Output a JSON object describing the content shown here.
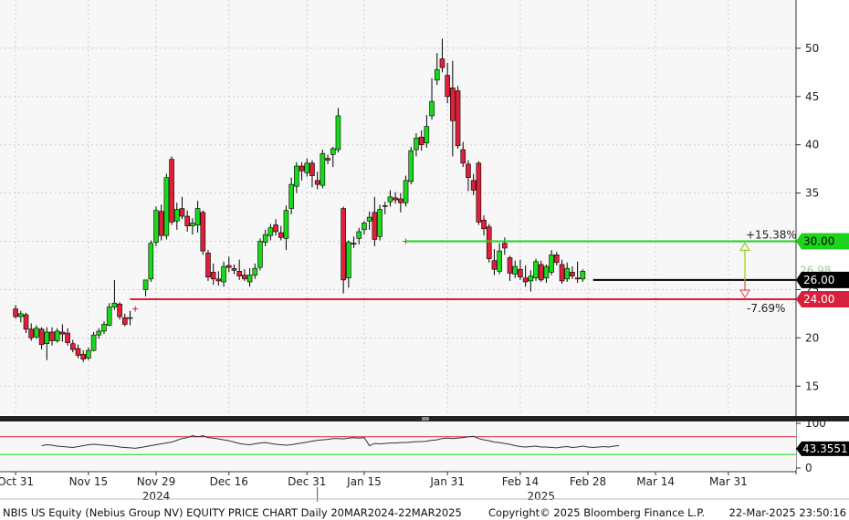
{
  "chart_data": {
    "type": "candlestick",
    "ylim": [
      12,
      55
    ],
    "yticks": [
      15,
      20,
      25,
      30,
      35,
      40,
      45,
      50
    ],
    "x_range": [
      -3,
      150
    ],
    "x_ticks": [
      {
        "i": 0,
        "label": "Oct 31"
      },
      {
        "i": 14,
        "label": "Nov 15"
      },
      {
        "i": 27,
        "label": "Nov 29"
      },
      {
        "i": 41,
        "label": "Dec 16"
      },
      {
        "i": 56,
        "label": "Dec 31"
      },
      {
        "i": 67,
        "label": "Jan 15"
      },
      {
        "i": 83,
        "label": "Jan 31"
      },
      {
        "i": 97,
        "label": "Feb 14"
      },
      {
        "i": 110,
        "label": "Feb 28"
      },
      {
        "i": 123,
        "label": "Mar 14"
      },
      {
        "i": 137,
        "label": "Mar 31"
      }
    ],
    "year_labels": [
      {
        "i": 27,
        "label": "2024"
      },
      {
        "i": 101,
        "label": "2025"
      }
    ],
    "candles": [
      [
        23.0,
        23.4,
        22.0,
        22.2
      ],
      [
        22.2,
        22.8,
        21.6,
        22.5
      ],
      [
        22.4,
        22.6,
        20.5,
        20.9
      ],
      [
        20.9,
        21.5,
        19.7,
        20.0
      ],
      [
        20.1,
        21.3,
        19.9,
        21.0
      ],
      [
        20.9,
        21.1,
        18.8,
        19.3
      ],
      [
        19.4,
        21.1,
        17.7,
        20.6
      ],
      [
        20.6,
        21.1,
        19.2,
        19.7
      ],
      [
        19.7,
        21.0,
        19.5,
        20.7
      ],
      [
        20.6,
        21.4,
        19.6,
        20.4
      ],
      [
        20.5,
        21.0,
        19.2,
        19.5
      ],
      [
        19.4,
        19.8,
        18.5,
        18.8
      ],
      [
        18.9,
        19.3,
        17.9,
        18.2
      ],
      [
        18.3,
        18.7,
        17.5,
        17.8
      ],
      [
        17.9,
        19.0,
        17.7,
        18.7
      ],
      [
        18.7,
        20.6,
        18.6,
        20.3
      ],
      [
        20.3,
        21.0,
        19.9,
        20.7
      ],
      [
        20.7,
        21.7,
        20.4,
        21.4
      ],
      [
        21.3,
        23.6,
        21.2,
        23.2
      ],
      [
        23.2,
        26.0,
        22.9,
        23.6
      ],
      [
        23.5,
        23.7,
        21.9,
        22.2
      ],
      [
        22.1,
        22.5,
        21.2,
        21.4
      ],
      [
        22.0,
        22.8,
        21.3,
        22.1
      ],
      [
        0,
        0,
        0,
        0
      ],
      [
        0,
        0,
        0,
        0
      ],
      [
        25.0,
        25.5,
        24.3,
        26.0
      ],
      [
        26.1,
        30.1,
        25.8,
        29.8
      ],
      [
        29.9,
        33.6,
        29.5,
        33.2
      ],
      [
        33.1,
        33.8,
        30.1,
        30.6
      ],
      [
        30.6,
        37.0,
        30.2,
        36.6
      ],
      [
        38.5,
        38.8,
        31.7,
        32.0
      ],
      [
        32.1,
        34.0,
        31.2,
        33.3
      ],
      [
        33.4,
        34.6,
        32.3,
        32.6
      ],
      [
        32.6,
        33.2,
        31.0,
        31.6
      ],
      [
        31.6,
        32.4,
        30.7,
        31.9
      ],
      [
        31.7,
        34.2,
        30.9,
        33.4
      ],
      [
        33.0,
        33.2,
        28.6,
        29.0
      ],
      [
        28.8,
        29.1,
        25.9,
        26.3
      ],
      [
        26.8,
        27.7,
        25.5,
        26.1
      ],
      [
        26.1,
        26.9,
        25.4,
        25.9
      ],
      [
        25.8,
        27.9,
        25.3,
        27.4
      ],
      [
        27.5,
        28.4,
        26.8,
        27.3
      ],
      [
        27.2,
        27.6,
        26.6,
        27.0
      ],
      [
        26.9,
        28.1,
        26.0,
        26.4
      ],
      [
        26.5,
        27.1,
        25.9,
        26.1
      ],
      [
        25.8,
        27.2,
        25.3,
        26.5
      ],
      [
        26.5,
        27.7,
        26.1,
        27.2
      ],
      [
        27.3,
        30.3,
        27.0,
        30.0
      ],
      [
        29.9,
        31.2,
        29.5,
        30.7
      ],
      [
        30.6,
        31.8,
        30.1,
        31.4
      ],
      [
        31.7,
        32.3,
        30.6,
        31.0
      ],
      [
        30.9,
        31.6,
        30.1,
        30.4
      ],
      [
        30.3,
        33.7,
        29.1,
        33.2
      ],
      [
        33.4,
        36.6,
        32.8,
        35.9
      ],
      [
        35.7,
        38.2,
        35.0,
        37.8
      ],
      [
        37.8,
        38.2,
        36.3,
        37.3
      ],
      [
        37.1,
        38.6,
        36.7,
        38.1
      ],
      [
        38.1,
        38.4,
        35.6,
        36.8
      ],
      [
        36.3,
        37.2,
        35.4,
        35.9
      ],
      [
        35.8,
        39.5,
        35.5,
        39.1
      ],
      [
        38.6,
        39.0,
        38.0,
        38.4
      ],
      [
        39.0,
        39.8,
        37.7,
        39.6
      ],
      [
        39.5,
        43.8,
        39.2,
        43.0
      ],
      [
        33.4,
        33.6,
        24.6,
        26.0
      ],
      [
        26.2,
        30.1,
        25.2,
        29.9
      ],
      [
        29.8,
        30.5,
        29.3,
        29.7
      ],
      [
        30.3,
        31.4,
        29.7,
        31.0
      ],
      [
        31.2,
        32.1,
        30.7,
        31.9
      ],
      [
        32.1,
        33.1,
        31.2,
        32.5
      ],
      [
        33.0,
        34.6,
        29.5,
        30.2
      ],
      [
        30.5,
        33.8,
        30.1,
        33.3
      ],
      [
        33.6,
        34.1,
        32.8,
        33.7
      ],
      [
        34.1,
        35.3,
        33.6,
        34.6
      ],
      [
        34.5,
        35.1,
        33.9,
        34.3
      ],
      [
        34.4,
        35.0,
        33.0,
        34.0
      ],
      [
        34.0,
        36.8,
        33.6,
        36.3
      ],
      [
        36.2,
        39.8,
        35.9,
        39.4
      ],
      [
        39.5,
        41.2,
        38.8,
        40.7
      ],
      [
        40.8,
        41.5,
        39.4,
        40.0
      ],
      [
        40.2,
        43.1,
        39.7,
        41.9
      ],
      [
        43.0,
        46.9,
        42.6,
        44.5
      ],
      [
        46.7,
        49.5,
        46.2,
        47.8
      ],
      [
        48.9,
        51.0,
        47.5,
        48.0
      ],
      [
        47.2,
        48.5,
        44.3,
        45.0
      ],
      [
        45.9,
        48.7,
        38.8,
        42.5
      ],
      [
        45.6,
        46.1,
        39.6,
        39.9
      ],
      [
        39.5,
        40.3,
        37.7,
        38.1
      ],
      [
        38.0,
        38.4,
        35.2,
        36.6
      ],
      [
        36.3,
        37.0,
        34.8,
        35.3
      ],
      [
        38.1,
        38.3,
        31.7,
        32.0
      ],
      [
        32.2,
        32.7,
        30.6,
        31.3
      ],
      [
        31.5,
        31.8,
        27.8,
        28.2
      ],
      [
        28.0,
        29.2,
        26.5,
        27.1
      ],
      [
        26.9,
        29.8,
        26.6,
        29.0
      ],
      [
        29.8,
        30.4,
        28.6,
        29.3
      ],
      [
        28.3,
        28.5,
        25.9,
        26.7
      ],
      [
        26.6,
        28.0,
        26.2,
        27.4
      ],
      [
        27.1,
        28.1,
        26.0,
        26.3
      ],
      [
        26.2,
        27.5,
        25.3,
        25.8
      ],
      [
        25.9,
        27.0,
        24.8,
        26.4
      ],
      [
        26.2,
        28.2,
        25.9,
        27.9
      ],
      [
        27.6,
        28.0,
        25.8,
        26.0
      ],
      [
        26.2,
        27.6,
        25.7,
        27.4
      ],
      [
        26.8,
        29.1,
        26.5,
        28.6
      ],
      [
        28.6,
        28.9,
        27.5,
        27.8
      ],
      [
        27.6,
        28.1,
        25.6,
        25.9
      ],
      [
        26.1,
        27.8,
        25.8,
        27.2
      ],
      [
        26.8,
        27.4,
        26.1,
        26.4
      ],
      [
        26.2,
        27.9,
        25.7,
        26.1
      ],
      [
        26.1,
        27.1,
        25.8,
        26.9
      ]
    ],
    "candle_x_start": 0,
    "candle_x_spacing": 1,
    "support_line": {
      "y": 24.0,
      "label": "24.00"
    },
    "resistance_line": {
      "y": 30.0,
      "label": "30.00"
    },
    "current_line": {
      "y": 26.0,
      "label": "26.00"
    },
    "faint_price_label": "26.98",
    "upside_pct": "+15.38%",
    "downside_pct": "-7.69%",
    "rsi": {
      "ylim": [
        0,
        100
      ],
      "yticks": [
        0,
        100
      ],
      "levels": [
        70,
        30
      ],
      "value_label": "43.3551",
      "values": [
        50,
        52,
        51,
        49,
        48,
        47,
        46,
        48,
        50,
        52,
        53,
        52,
        51,
        50,
        49,
        47,
        46,
        45,
        44,
        46,
        48,
        50,
        52,
        54,
        56,
        58,
        62,
        66,
        68,
        72,
        70,
        72,
        68,
        67,
        65,
        63,
        61,
        58,
        55,
        53,
        52,
        54,
        56,
        57,
        55,
        53,
        52,
        51,
        52,
        54,
        56,
        58,
        60,
        62,
        63,
        64,
        66,
        66,
        65,
        67,
        68,
        67,
        68,
        50,
        55,
        54,
        55,
        56,
        56,
        57,
        57,
        58,
        59,
        59,
        60,
        62,
        63,
        66,
        67,
        66,
        67,
        68,
        70,
        71,
        66,
        63,
        61,
        58,
        57,
        55,
        53,
        50,
        48,
        47,
        48,
        49,
        47,
        47,
        46,
        45,
        47,
        48,
        46,
        47,
        49,
        47,
        46,
        47,
        48,
        47,
        49,
        50
      ]
    }
  },
  "footer": {
    "left": "NBIS US Equity (Nebius Group NV) EQUITY PRICE CHART  Daily 20MAR2024-22MAR2025",
    "center": "Copyright© 2025 Bloomberg Finance L.P.",
    "right": "22-Mar-2025 23:50:16"
  },
  "colors": {
    "up": "#19d919",
    "down": "#e0203a",
    "grid": "#cfcfcf",
    "support": "#d8203a",
    "resistance": "#1cd41c",
    "current": "#000000"
  }
}
